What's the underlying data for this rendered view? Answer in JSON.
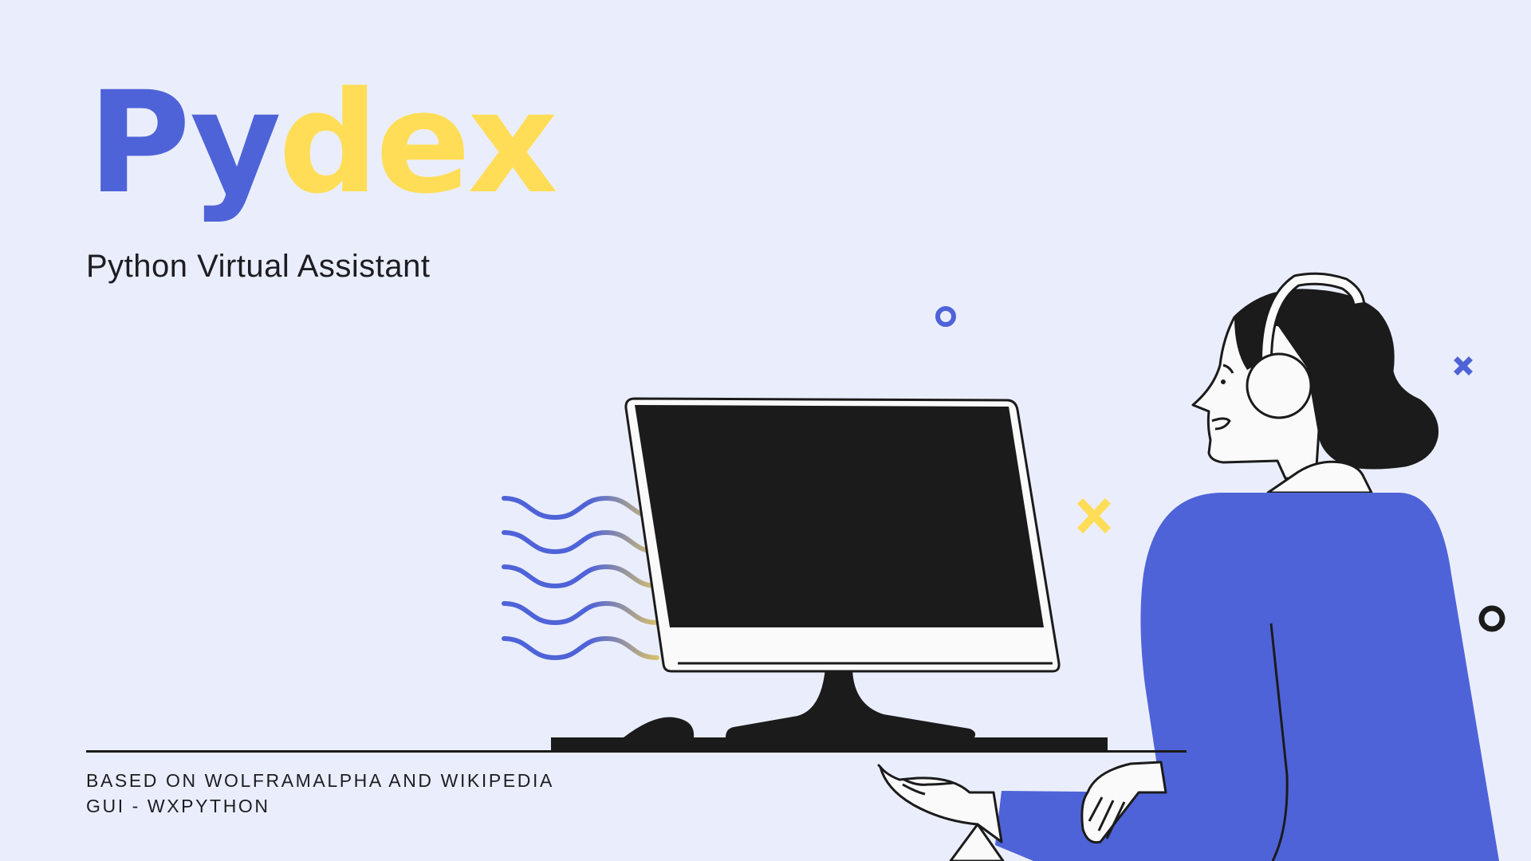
{
  "title": {
    "part1": "Py",
    "part2": "dex"
  },
  "subtitle": "Python Virtual Assistant",
  "footer": {
    "line1": "BASED ON WOLFRAMALPHA AND WIKIPEDIA",
    "line2": "GUI - WXPYTHON"
  },
  "colors": {
    "background": "#eaeefc",
    "accent_blue": "#4f63d8",
    "accent_yellow": "#ffdd57",
    "ink": "#1b1b1b"
  },
  "illustration": {
    "subject": "person-with-headphones-at-computer-icon"
  }
}
